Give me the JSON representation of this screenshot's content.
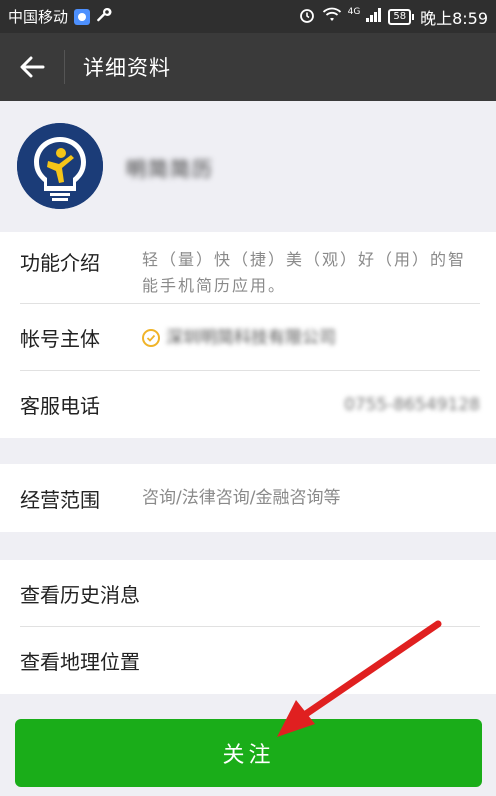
{
  "status_bar": {
    "carrier": "中国移动",
    "network": "4G",
    "battery": "58",
    "time": "晚上8:59"
  },
  "titlebar": {
    "title": "详细资料"
  },
  "profile": {
    "name": "明简简历"
  },
  "info_rows": [
    {
      "label": "功能介绍",
      "value": "轻（量）快（捷）美（观）好（用）的智能手机简历应用。"
    },
    {
      "label": "帐号主体",
      "value": "深圳明简科技有限公司"
    },
    {
      "label": "客服电话",
      "value": "0755-86549128"
    }
  ],
  "scope_row": {
    "label": "经营范围",
    "value": "咨询/法律咨询/金融咨询等"
  },
  "nav_rows": [
    {
      "label": "查看历史消息"
    },
    {
      "label": "查看地理位置"
    }
  ],
  "follow_button": {
    "label": "关注"
  },
  "colors": {
    "accent_green": "#1aad19",
    "titlebar_bg": "#3a3a3a",
    "annotation_arrow": "#e02020"
  }
}
